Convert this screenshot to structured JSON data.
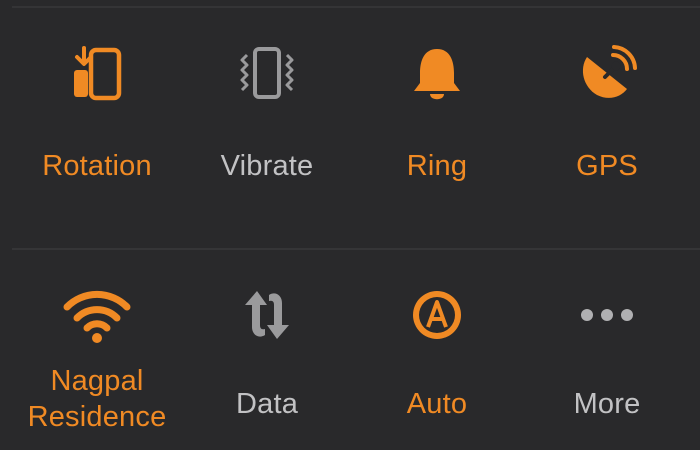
{
  "colors": {
    "accent": "#f08a24",
    "inactive": "#9a9a9c",
    "background": "#29292b"
  },
  "toggles": {
    "rotation": {
      "label": "Rotation",
      "icon": "rotation-icon",
      "active": true
    },
    "vibrate": {
      "label": "Vibrate",
      "icon": "vibrate-icon",
      "active": false
    },
    "ring": {
      "label": "Ring",
      "icon": "bell-icon",
      "active": true
    },
    "gps": {
      "label": "GPS",
      "icon": "satellite-dish-icon",
      "active": true
    },
    "wifi": {
      "label_line1": "Nagpal",
      "label_line2": "Residence",
      "icon": "wifi-icon",
      "active": true
    },
    "data": {
      "label": "Data",
      "icon": "data-sync-icon",
      "active": false
    },
    "auto": {
      "label": "Auto",
      "icon": "auto-brightness-icon",
      "active": true
    },
    "more": {
      "label": "More",
      "icon": "more-icon",
      "active": false
    }
  }
}
